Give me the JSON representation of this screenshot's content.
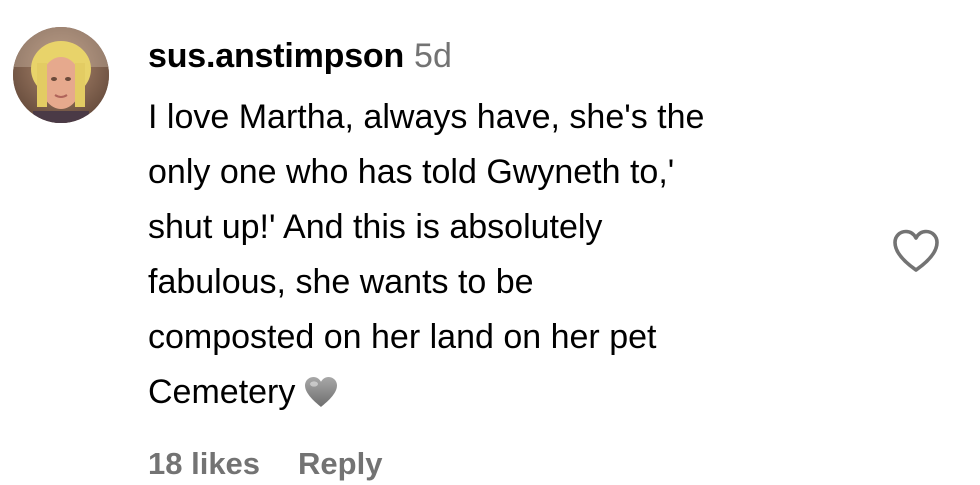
{
  "comment": {
    "username": "sus.anstimpson",
    "time": "5d",
    "text_lines": [
      "I love Martha, always have, she's the",
      "only one who has told Gwyneth to,'",
      "shut up!' And this is absolutely",
      "fabulous, she wants to be",
      "composted on her land on her pet",
      "Cemetery"
    ],
    "emoji": "grey-heart-icon",
    "likes": "18 likes",
    "reply_label": "Reply",
    "like_icon": "heart-outline-icon"
  },
  "colors": {
    "text": "#000000",
    "secondary": "#737373",
    "icon": "#737373",
    "emoji": "#8e8e8e"
  }
}
